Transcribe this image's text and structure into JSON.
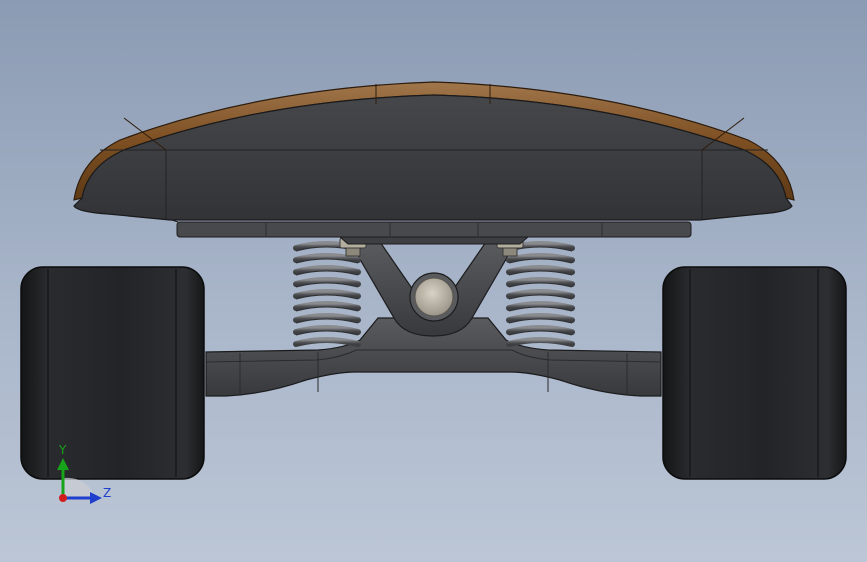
{
  "viewport": {
    "background_top": "#8b9bb3",
    "background_bottom": "#bcc6d6"
  },
  "model": {
    "parts": [
      "deck",
      "baseplate",
      "springs",
      "hanger",
      "pivot-bushing",
      "left-wheel",
      "right-wheel"
    ],
    "colors": {
      "deck_wood": "#8a5a2b",
      "deck_body": "#3c3d40",
      "truck_metal": "#4a4b4e",
      "spring": "#6a6b6f",
      "wheel": "#1f2022",
      "bushing": "#b9b3a6"
    }
  },
  "triad": {
    "y_label": "Y",
    "z_label": "Z",
    "y_color": "#17a31a",
    "z_color": "#1f3fcc",
    "x_color": "#d11c1c"
  }
}
